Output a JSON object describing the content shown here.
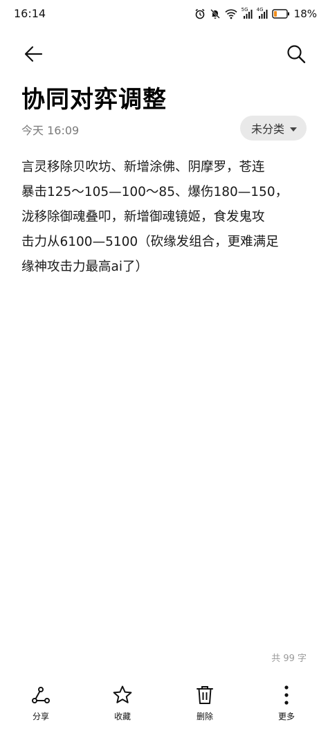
{
  "status_bar": {
    "time": "16:14",
    "battery": "18%",
    "network_1": "5G",
    "network_2": "4G",
    "icons": [
      "alarm-icon",
      "mute-icon",
      "wifi-icon",
      "signal-icon",
      "signal-icon",
      "battery-icon"
    ]
  },
  "top_bar": {
    "back_icon": "arrow-left-icon",
    "search_icon": "search-icon"
  },
  "note": {
    "title": "协同对弈调整",
    "date": "今天 16:09",
    "category": "未分类",
    "body_lines": [
      "言灵移除贝吹坊、新增涂佛、阴摩罗，苍连",
      "暴击125～105—100～85、爆伤180—150，",
      "泷移除御魂叠叩，新增御魂镜姬，食发鬼攻",
      "击力从6100—5100（砍缘发组合，更难满足",
      "缘神攻击力最高ai了）"
    ],
    "char_count": "共 99 字"
  },
  "toolbar": {
    "share_label": "分享",
    "favorite_label": "收藏",
    "delete_label": "删除",
    "more_label": "更多"
  },
  "colors": {
    "background": "#ffffff",
    "text": "#000000",
    "secondary_text": "#7a7a7a",
    "chip_background": "#e9e9e9",
    "battery_low": "#f08c1a"
  }
}
